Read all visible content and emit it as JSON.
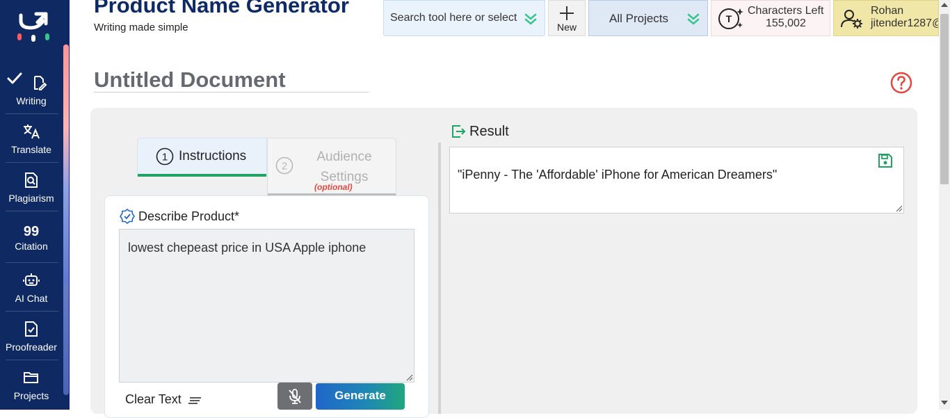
{
  "sidebar": {
    "items": [
      {
        "label": "Writing",
        "icon": "writing-icon",
        "active": true
      },
      {
        "label": "Translate",
        "icon": "translate-icon"
      },
      {
        "label": "Plagiarism",
        "icon": "plagiarism-icon"
      },
      {
        "label": "Citation",
        "icon": "citation-icon"
      },
      {
        "label": "AI Chat",
        "icon": "ai-chat-icon"
      },
      {
        "label": "Proofreader",
        "icon": "proofreader-icon"
      },
      {
        "label": "Projects",
        "icon": "projects-icon"
      }
    ],
    "citation_glyph": "99"
  },
  "header": {
    "title": "Product Name Generator",
    "subtitle": "Writing made simple",
    "search_text": "Search tool here or select",
    "new_label": "New",
    "projects_label": "All Projects",
    "chars_label": "Characters Left",
    "chars_value": "155,002",
    "user_name": "Rohan",
    "user_id": "jitender1287@"
  },
  "document": {
    "title": "Untitled Document"
  },
  "tabs": {
    "instructions": {
      "number": "1",
      "label": "Instructions"
    },
    "audience": {
      "number": "2",
      "label": "Audience Settings",
      "optional": "(optional)"
    }
  },
  "form": {
    "field_label": "Describe Product*",
    "field_value": "lowest chepeast price in USA Apple iphone",
    "clear_label": "Clear Text",
    "generate_label": "Generate"
  },
  "result": {
    "heading": "Result",
    "text": "\"iPenny - The 'Affordable' iPhone for American Dreamers\""
  },
  "colors": {
    "sidebar_bg": "#0f2a63",
    "accent_green": "#21a366",
    "accent_blue": "#1f66c9",
    "title_navy": "#0d2a66",
    "help_red": "#e2463d"
  }
}
